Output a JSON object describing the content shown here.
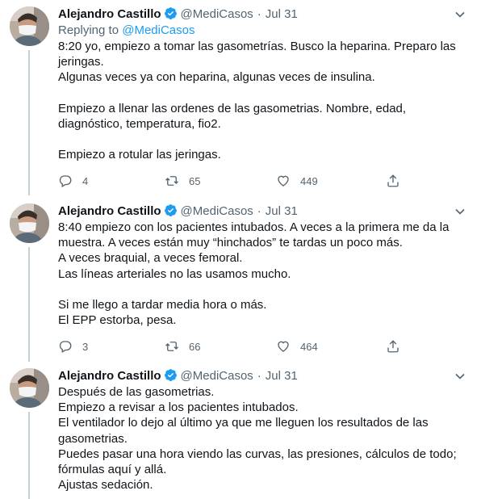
{
  "tweets": [
    {
      "name": "Alejandro Castillo",
      "handle": "@MediCasos",
      "separator": "·",
      "date": "Jul 31",
      "replying_prefix": "Replying to",
      "replying_to": "@MediCasos",
      "lines": [
        "8:20 yo, empiezo a tomar las gasometrías. Busco la heparina. Preparo las",
        "jeringas.",
        "Algunas veces ya con heparina, algunas veces de insulina.",
        "",
        "Empiezo a llenar las ordenes de las gasometrias. Nombre, edad,",
        "diagnóstico, temperatura, fio2.",
        "",
        "Empiezo a rotular las jeringas."
      ],
      "replies": "4",
      "retweets": "65",
      "likes": "449"
    },
    {
      "name": "Alejandro Castillo",
      "handle": "@MediCasos",
      "separator": "·",
      "date": "Jul 31",
      "lines": [
        "8:40 empiezo con los pacientes intubados. A veces a la primera me da la",
        "muestra. A veces están muy “hinchados” te tardas un poco más.",
        "A veces braquial, a veces femoral.",
        "Las líneas arteriales no las usamos mucho.",
        "",
        "Si me llego a tardar media hora o más.",
        "El EPP estorba, pesa."
      ],
      "replies": "3",
      "retweets": "66",
      "likes": "464"
    },
    {
      "name": "Alejandro Castillo",
      "handle": "@MediCasos",
      "separator": "·",
      "date": "Jul 31",
      "lines": [
        "Después de las gasometrias.",
        "Empiezo a revisar a los pacientes intubados.",
        "El ventilador lo dejo al último ya que me lleguen los resultados de las",
        "gasometrias.",
        "Puedes pasar una hora viendo las curvas, las presiones, cálculos de todo;",
        "fórmulas aquí y allá.",
        "Ajustas sedación."
      ]
    }
  ],
  "colors": {
    "text": "#0f1419",
    "secondary": "#536471",
    "accent": "#1d9bf0",
    "thread_line": "#c4cfd6"
  }
}
